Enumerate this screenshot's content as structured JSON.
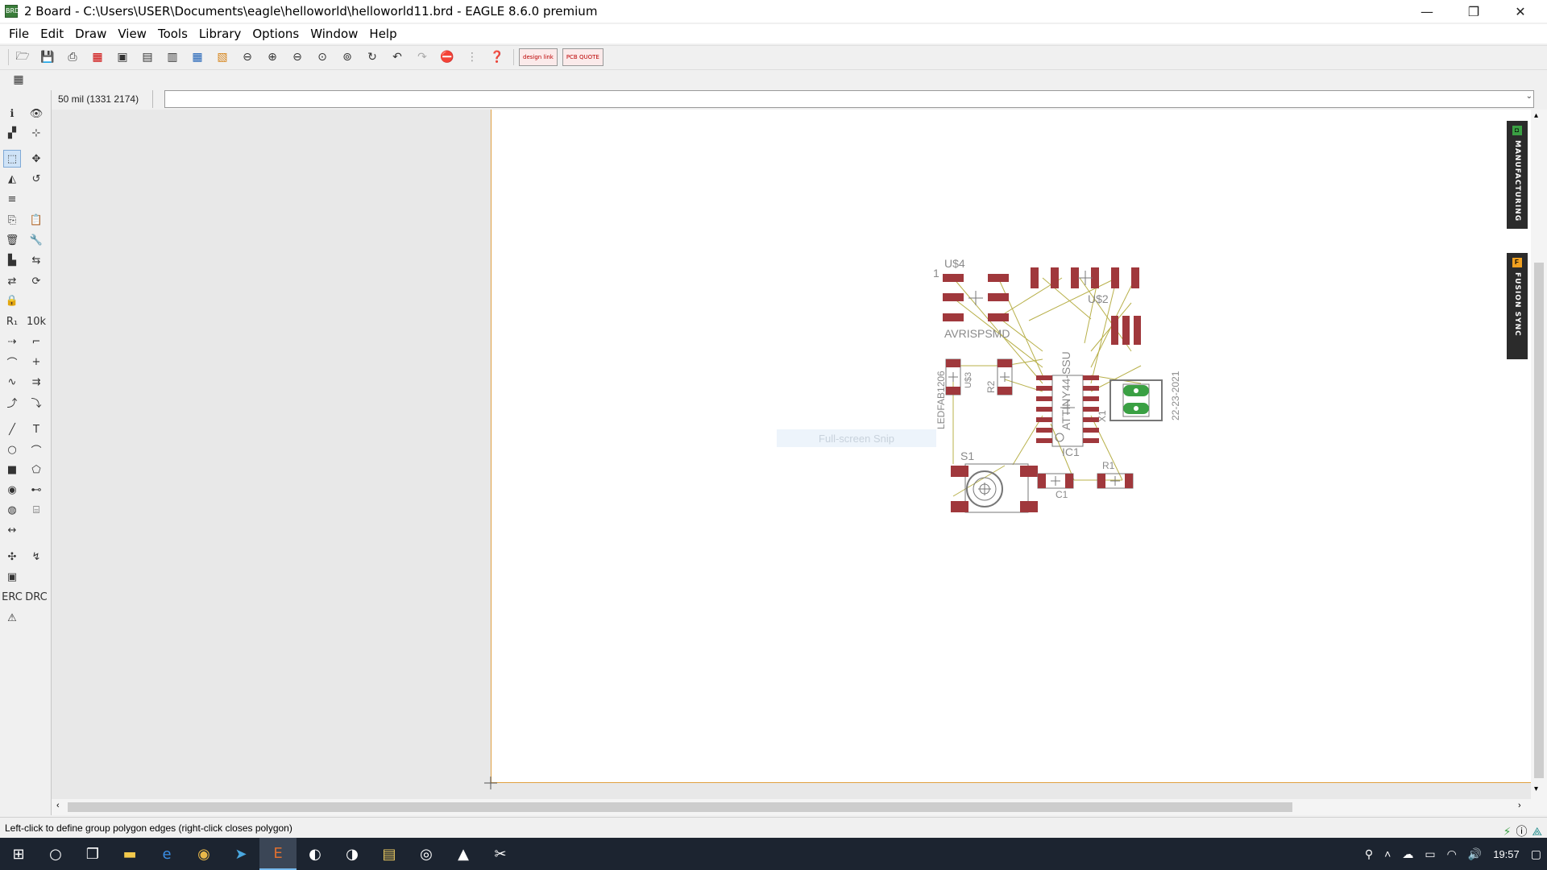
{
  "window": {
    "title": "2 Board - C:\\Users\\USER\\Documents\\eagle\\helloworld\\helloworld11.brd - EAGLE 8.6.0 premium",
    "minimize": "—",
    "maximize": "❐",
    "close": "✕"
  },
  "menu": [
    {
      "label": "File"
    },
    {
      "label": "Edit"
    },
    {
      "label": "Draw"
    },
    {
      "label": "View"
    },
    {
      "label": "Tools"
    },
    {
      "label": "Library"
    },
    {
      "label": "Options"
    },
    {
      "label": "Window"
    },
    {
      "label": "Help"
    }
  ],
  "toolbar": {
    "design_link": "design link",
    "pcb_quote": "PCB QUOTE"
  },
  "command": {
    "grid_readout": "50 mil (1331 2174)",
    "input_value": ""
  },
  "board": {
    "labels": {
      "usd4": "U$4",
      "pin1": "1",
      "usd2": "U$2",
      "avrispsmd": "AVRISPSMD",
      "ledfab": "LEDFAB1206",
      "usd3": "U$3",
      "r2": "R2",
      "attiny": "ATTINY44-SSU",
      "x1": "X1",
      "date": "22-23-2021",
      "ic1": "IC1",
      "s1": "S1",
      "r1": "R1",
      "c1": "C1"
    }
  },
  "overlay": {
    "snip": "Full-screen Snip"
  },
  "sidetabs": {
    "manufacturing": "MANUFACTURING",
    "fusion_sync": "FUSION SYNC"
  },
  "status": {
    "message": "Left-click to define group polygon edges (right-click closes polygon)"
  },
  "taskbar": {
    "time": "19:57"
  },
  "colors": {
    "pad": "#a0383c",
    "airwire": "#b8b04a",
    "board_outline": "#e0a040",
    "silk": "#8a8a8a",
    "via_green": "#3aa043"
  }
}
